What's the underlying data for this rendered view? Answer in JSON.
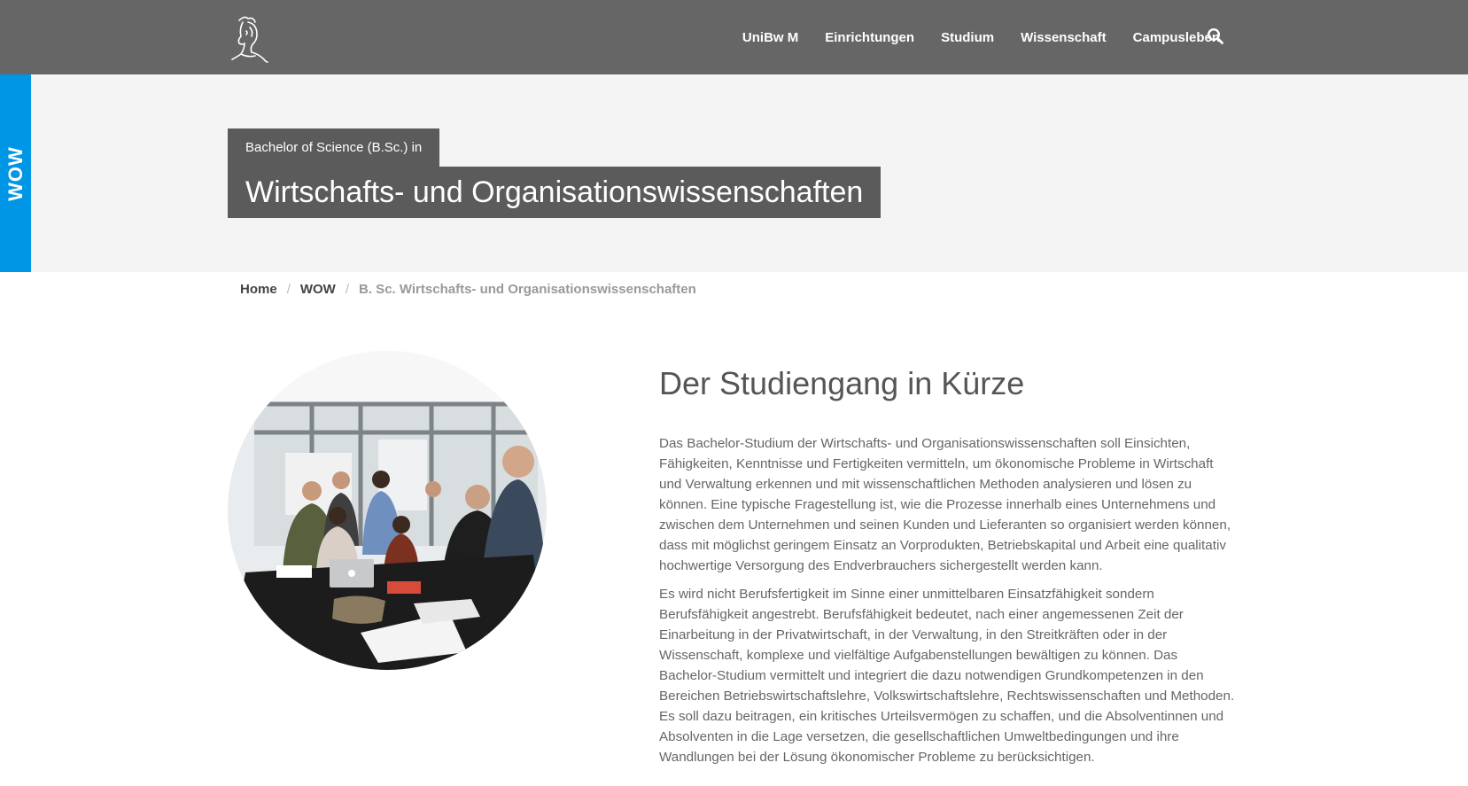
{
  "header": {
    "nav": [
      {
        "label": "UniBw M"
      },
      {
        "label": "Einrichtungen"
      },
      {
        "label": "Studium"
      },
      {
        "label": "Wissenschaft"
      },
      {
        "label": "Campusleben"
      }
    ],
    "search_icon": "search-icon",
    "logo_icon": "athena-head-logo"
  },
  "side_tab": {
    "label": "WOW",
    "color": "#0096e6"
  },
  "hero": {
    "degree": "Bachelor of Science (B.Sc.) in",
    "title": "Wirtschafts- und Organisationswissenschaften"
  },
  "breadcrumb": {
    "items": [
      "Home",
      "WOW"
    ],
    "separator": "/",
    "current": "B. Sc. Wirtschafts- und Organisationswissenschaften"
  },
  "main": {
    "heading": "Der Studiengang in Kürze",
    "paragraphs": [
      "Das Bachelor-Studium der Wirtschafts- und Organisationswissenschaften soll Einsichten, Fähigkeiten, Kenntnisse und Fertigkeiten vermitteln, um ökonomische Probleme in Wirtschaft und Verwaltung erkennen und mit wissenschaftlichen Methoden analysieren und lösen zu können. Eine typische Fragestellung ist, wie die Prozesse innerhalb eines Unternehmens und zwischen dem Unternehmen und seinen Kunden und Lieferanten so organisiert werden können, dass mit möglichst geringem Einsatz an Vorprodukten, Betriebskapital und Arbeit eine qualitativ hochwertige Versorgung des Endverbrauchers sichergestellt werden kann.",
      "Es wird nicht Berufsfertigkeit im Sinne einer unmittelbaren Einsatzfähigkeit sondern Berufsfähigkeit angestrebt. Berufsfähigkeit bedeutet, nach einer angemessenen Zeit der Einarbeitung in der Privatwirtschaft, in der Verwaltung, in den Streitkräften oder in der Wissenschaft, komplexe und vielfältige Aufgabenstellungen bewältigen zu können. Das Bachelor-Studium vermittelt und integriert die dazu notwendigen Grundkompetenzen in den Bereichen Betriebswirtschaftslehre, Volkswirtschaftslehre, Rechtswissenschaften und Methoden. Es soll dazu beitragen, ein kritisches Urteilsvermögen zu schaffen, und die Absolventinnen und Absolventen in die Lage versetzen, die gesellschaftlichen Umweltbedingungen und ihre Wandlungen bei der Lösung ökonomischer Probleme zu berücksichtigen."
    ]
  },
  "colors": {
    "topbar": "#666666",
    "hero_bg": "#f4f4f4",
    "title_box": "#5b5b5b",
    "accent": "#0096e6"
  }
}
